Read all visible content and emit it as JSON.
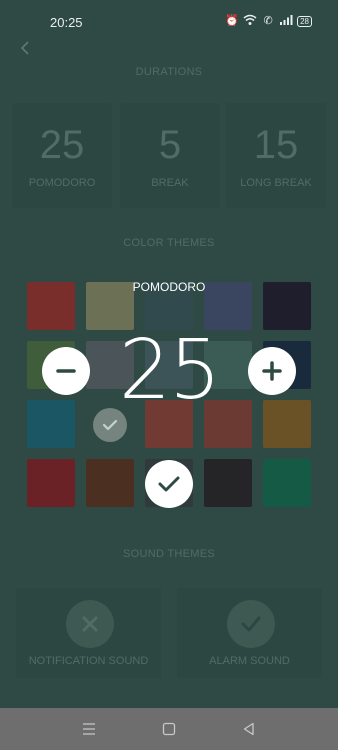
{
  "status": {
    "time": "20:25",
    "battery": "28",
    "icons": [
      "alarm-icon",
      "wifi-icon",
      "call-icon",
      "signal-icon",
      "battery-icon"
    ]
  },
  "sections": {
    "durations": "DURATIONS",
    "color_themes": "COLOR THEMES",
    "sound_themes": "SOUND THEMES"
  },
  "durations": [
    {
      "value": "25",
      "label": "POMODORO"
    },
    {
      "value": "5",
      "label": "BREAK"
    },
    {
      "value": "15",
      "label": "LONG BREAK"
    }
  ],
  "color_themes": {
    "rows": [
      [
        "#7a2e2c",
        "#6c7155",
        "#304a4d",
        "#3a4660",
        "#1f1e2c"
      ],
      [
        "#3f5c3b",
        "#4b5559",
        "#3c5457",
        "#3b5b55",
        "#1a2a3d"
      ],
      [
        "#1a5664",
        "#2f4a44",
        "#713a33",
        "#6b3a32",
        "#6b5226"
      ],
      [
        "#6a2226",
        "#4b3022",
        "#303a3c",
        "#252427",
        "#155a44"
      ]
    ],
    "selected": "row 4, column 3"
  },
  "overlay": {
    "title": "POMODORO",
    "value": "25"
  },
  "sounds": [
    {
      "label": "NOTIFICATION SOUND",
      "icon": "close-icon"
    },
    {
      "label": "ALARM SOUND",
      "icon": "check-icon"
    }
  ],
  "nav": [
    "menu-icon",
    "home-icon",
    "back-icon"
  ],
  "colors": {
    "background": "#2f4a44",
    "card": "#2c4641",
    "muted_text": "#536b65",
    "nav_bar": "#6e6e6e"
  }
}
